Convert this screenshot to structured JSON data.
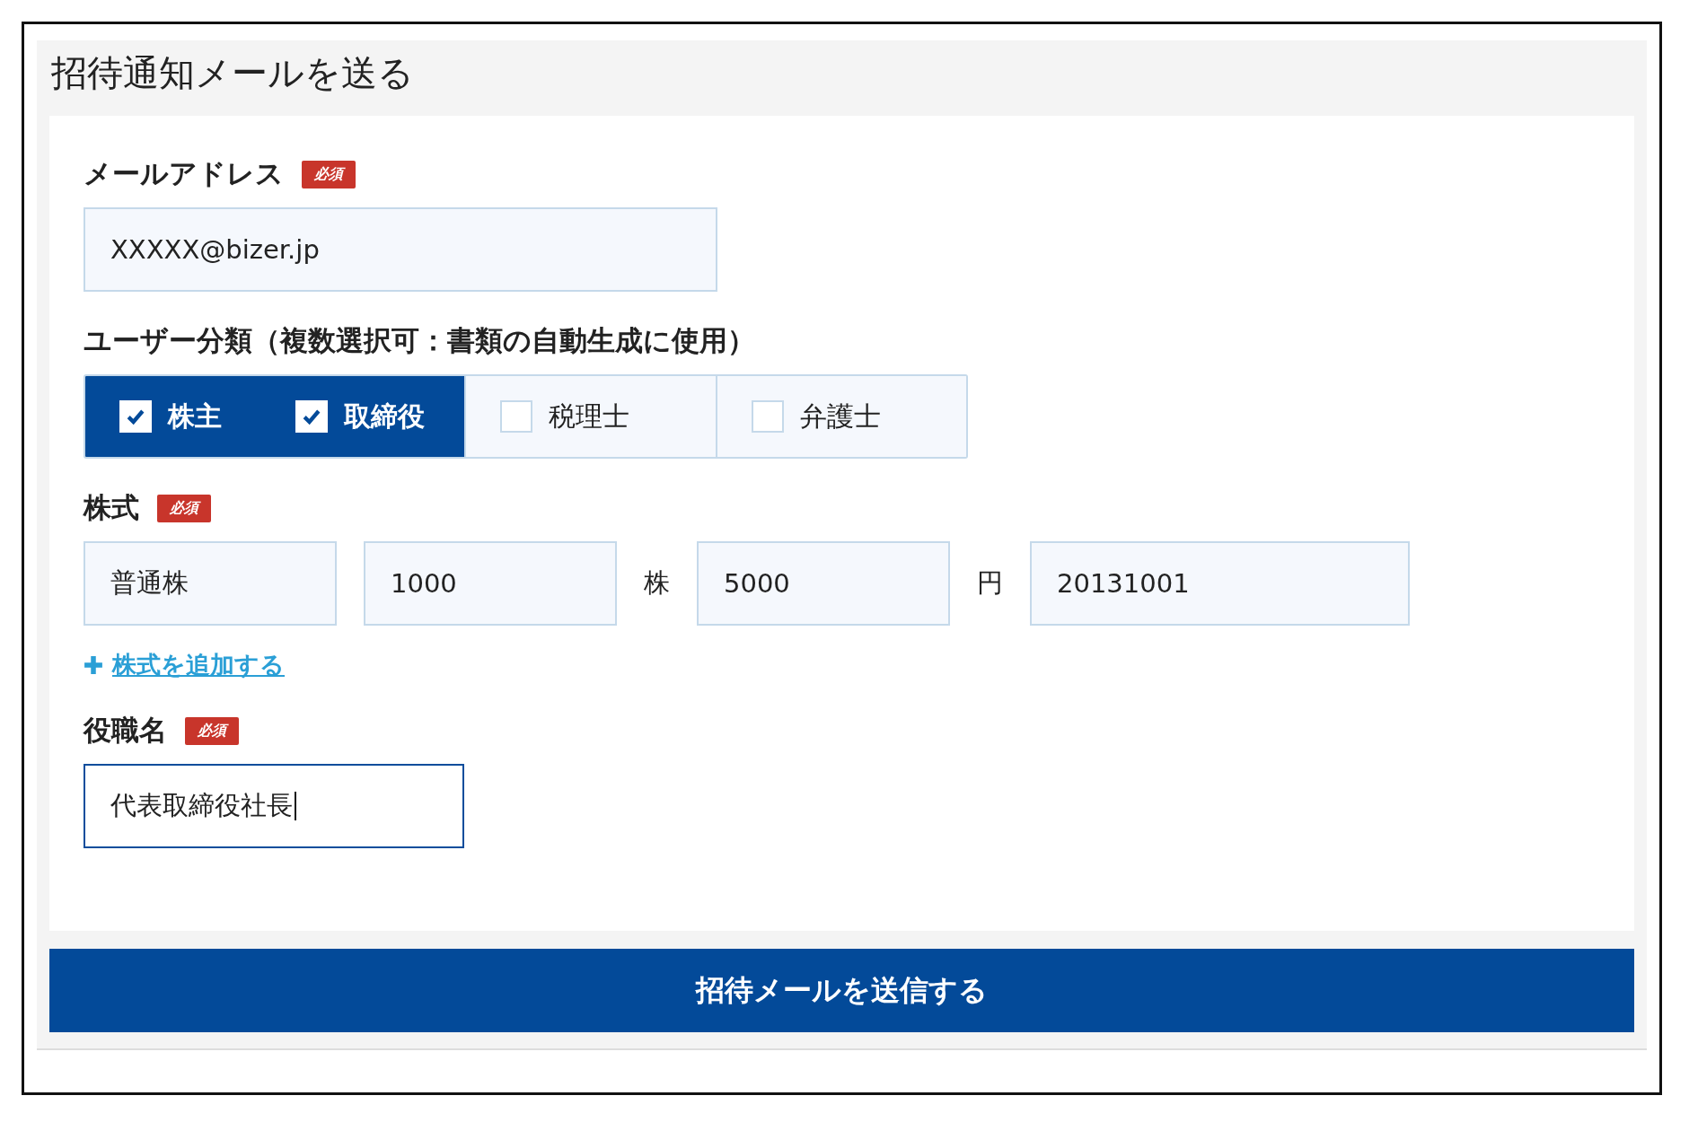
{
  "title": "招待通知メールを送る",
  "email": {
    "label": "メールアドレス",
    "required_badge": "必須",
    "value": "XXXXX@bizer.jp"
  },
  "user_category": {
    "label": "ユーザー分類（複数選択可：書類の自動生成に使用）",
    "options": [
      {
        "label": "株主",
        "checked": true
      },
      {
        "label": "取締役",
        "checked": true
      },
      {
        "label": "税理士",
        "checked": false
      },
      {
        "label": "弁護士",
        "checked": false
      }
    ]
  },
  "stock": {
    "label": "株式",
    "required_badge": "必須",
    "row": [
      {
        "kind": "field",
        "value": "普通株"
      },
      {
        "kind": "field",
        "value": "1000"
      },
      {
        "kind": "unit",
        "value": "株"
      },
      {
        "kind": "field",
        "value": "5000"
      },
      {
        "kind": "unit",
        "value": "円"
      },
      {
        "kind": "field",
        "value": "20131001"
      }
    ],
    "add_link": "株式を追加する"
  },
  "position": {
    "label": "役職名",
    "required_badge": "必須",
    "value": "代表取締役社長",
    "focused": true
  },
  "submit_button": "招待メールを送信する"
}
